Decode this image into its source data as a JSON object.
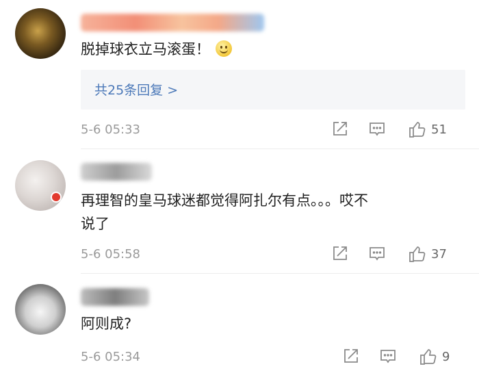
{
  "comments": [
    {
      "text": "脱掉球衣立马滚蛋！",
      "emoji": "smile-emoji",
      "replies_label": "共25条回复 >",
      "time": "5-6 05:33",
      "likes": "51"
    },
    {
      "text": "再理智的皇马球迷都觉得阿扎尔有点。。。哎不\n说了",
      "time": "5-6 05:58",
      "likes": "37"
    },
    {
      "text": "阿则成?",
      "time": "5-6 05:34",
      "likes": "9"
    }
  ],
  "icons": {
    "share": "share-icon",
    "comment": "comment-icon",
    "like": "thumbs-up-icon"
  },
  "colors": {
    "link": "#4b78b8",
    "meta": "#9a9a9a",
    "icon": "#8a8a8a"
  }
}
